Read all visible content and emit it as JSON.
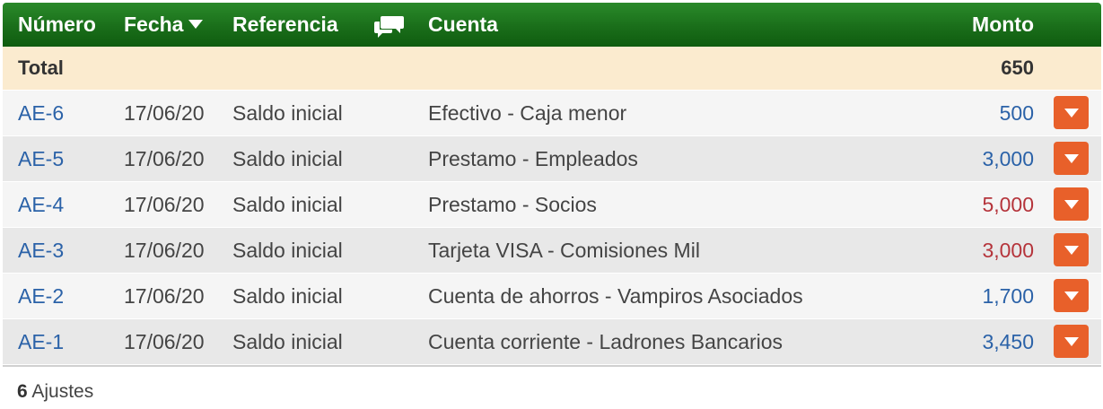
{
  "header": {
    "numero": "Número",
    "fecha": "Fecha",
    "referencia": "Referencia",
    "cuenta": "Cuenta",
    "monto": "Monto",
    "comment_icon": "comments-icon",
    "sort_icon": "caret-down-icon"
  },
  "total": {
    "label": "Total",
    "amount": "650"
  },
  "rows": [
    {
      "numero": "AE-6",
      "fecha": "17/06/20",
      "referencia": "Saldo inicial",
      "cuenta": "Efectivo - Caja menor",
      "monto": "500",
      "monto_color": "blue"
    },
    {
      "numero": "AE-5",
      "fecha": "17/06/20",
      "referencia": "Saldo inicial",
      "cuenta": "Prestamo - Empleados",
      "monto": "3,000",
      "monto_color": "blue"
    },
    {
      "numero": "AE-4",
      "fecha": "17/06/20",
      "referencia": "Saldo inicial",
      "cuenta": "Prestamo - Socios",
      "monto": "5,000",
      "monto_color": "red"
    },
    {
      "numero": "AE-3",
      "fecha": "17/06/20",
      "referencia": "Saldo inicial",
      "cuenta": "Tarjeta VISA - Comisiones Mil",
      "monto": "3,000",
      "monto_color": "red"
    },
    {
      "numero": "AE-2",
      "fecha": "17/06/20",
      "referencia": "Saldo inicial",
      "cuenta": "Cuenta de ahorros - Vampiros Asociados",
      "monto": "1,700",
      "monto_color": "blue"
    },
    {
      "numero": "AE-1",
      "fecha": "17/06/20",
      "referencia": "Saldo inicial",
      "cuenta": "Cuenta corriente - Ladrones Bancarios",
      "monto": "3,450",
      "monto_color": "blue"
    }
  ],
  "footer": {
    "count": "6",
    "label": "Ajustes"
  },
  "colors": {
    "header_green": "#1a6e1a",
    "total_bg": "#fbebcf",
    "action_orange": "#e8602a",
    "link_blue": "#2b62a8",
    "negative_red": "#b5343b"
  }
}
